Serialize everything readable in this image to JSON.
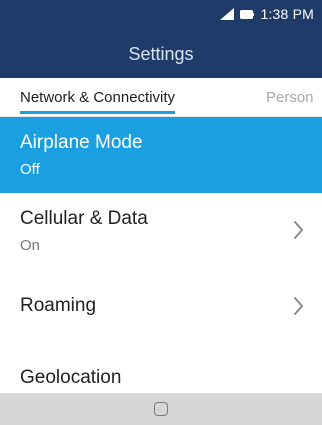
{
  "status_bar": {
    "time": "1:38 PM",
    "signal_icon": "signal-icon",
    "battery_icon": "battery-icon"
  },
  "header": {
    "title": "Settings"
  },
  "tabs": [
    {
      "label": "Network & Connectivity",
      "active": true
    },
    {
      "label": "Person",
      "active": false
    }
  ],
  "list": [
    {
      "label": "Airplane Mode",
      "value": "Off",
      "selected": true
    },
    {
      "label": "Cellular & Data",
      "value": "On",
      "selected": false
    },
    {
      "label": "Roaming",
      "value": "",
      "selected": false
    },
    {
      "label": "Geolocation",
      "value": "",
      "selected": false
    }
  ],
  "softkeys": {
    "center_icon": "center-key-icon"
  },
  "colors": {
    "header_bg": "#1f3b6a",
    "accent": "#1aa0e1",
    "softkey_bg": "#d6d6d6"
  }
}
